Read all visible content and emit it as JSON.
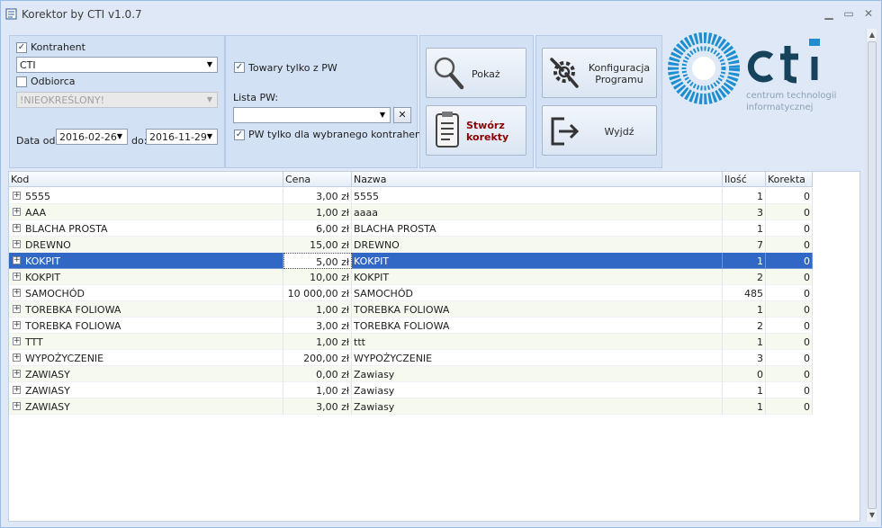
{
  "window": {
    "title": "Korektor by CTI v1.0.7"
  },
  "filters": {
    "kontrahent_label": "Kontrahent",
    "kontrahent_checked": true,
    "kontrahent_value": "CTI",
    "odbiorca_label": "Odbiorca",
    "odbiorca_checked": false,
    "odbiorca_value": "!NIEOKREŚLONY!",
    "date_from_label": "Data od:",
    "date_from": "2016-02-26",
    "date_to_label": "do:",
    "date_to": "2016-11-29"
  },
  "pw": {
    "towary_label": "Towary tylko z PW",
    "towary_checked": true,
    "lista_label": "Lista PW:",
    "lista_value": "",
    "clear_label": "✕",
    "tylko_label": "PW tylko dla wybranego kontrahenta",
    "tylko_checked": true
  },
  "buttons": {
    "pokaz": "Pokaż",
    "stworz_line1": "Stwórz",
    "stworz_line2": "korekty",
    "konfig_line1": "Konfiguracja",
    "konfig_line2": "Programu",
    "wyjdz": "Wyjdź"
  },
  "logo": {
    "brand": "cti",
    "tagline1": "centrum technologii",
    "tagline2": "informatycznej"
  },
  "grid": {
    "columns": [
      "Kod",
      "Cena",
      "Nazwa",
      "Ilość",
      "Korekta"
    ],
    "rows": [
      {
        "kod": "5555",
        "cena": "3,00 zł",
        "nazwa": "5555",
        "ilosc": "1",
        "korekta": "0"
      },
      {
        "kod": "AAA",
        "cena": "1,00 zł",
        "nazwa": "aaaa",
        "ilosc": "3",
        "korekta": "0"
      },
      {
        "kod": "BLACHA PROSTA",
        "cena": "6,00 zł",
        "nazwa": "BLACHA PROSTA",
        "ilosc": "1",
        "korekta": "0"
      },
      {
        "kod": "DREWNO",
        "cena": "15,00 zł",
        "nazwa": "DREWNO",
        "ilosc": "7",
        "korekta": "0"
      },
      {
        "kod": "KOKPIT",
        "cena": "5,00 zł",
        "nazwa": "KOKPIT",
        "ilosc": "1",
        "korekta": "0"
      },
      {
        "kod": "KOKPIT",
        "cena": "10,00 zł",
        "nazwa": "KOKPIT",
        "ilosc": "2",
        "korekta": "0"
      },
      {
        "kod": "SAMOCHÓD",
        "cena": "10 000,00 zł",
        "nazwa": "SAMOCHÓD",
        "ilosc": "485",
        "korekta": "0"
      },
      {
        "kod": "TOREBKA FOLIOWA",
        "cena": "1,00 zł",
        "nazwa": "TOREBKA FOLIOWA",
        "ilosc": "1",
        "korekta": "0"
      },
      {
        "kod": "TOREBKA FOLIOWA",
        "cena": "3,00 zł",
        "nazwa": "TOREBKA FOLIOWA",
        "ilosc": "2",
        "korekta": "0"
      },
      {
        "kod": "TTT",
        "cena": "1,00 zł",
        "nazwa": "ttt",
        "ilosc": "1",
        "korekta": "0"
      },
      {
        "kod": "WYPOŻYCZENIE",
        "cena": "200,00 zł",
        "nazwa": "WYPOŻYCZENIE",
        "ilosc": "3",
        "korekta": "0"
      },
      {
        "kod": "ZAWIASY",
        "cena": "0,00 zł",
        "nazwa": "Zawiasy",
        "ilosc": "0",
        "korekta": "0"
      },
      {
        "kod": "ZAWIASY",
        "cena": "1,00 zł",
        "nazwa": "Zawiasy",
        "ilosc": "1",
        "korekta": "0"
      },
      {
        "kod": "ZAWIASY",
        "cena": "3,00 zł",
        "nazwa": "Zawiasy",
        "ilosc": "1",
        "korekta": "0"
      }
    ],
    "selected_index": 4
  },
  "colors": {
    "selection": "#3168c6",
    "logo_blue": "#1d8fd1",
    "logo_dark": "#16425c",
    "stworz_text": "#8b0000"
  },
  "icons": {
    "app": "app-icon",
    "pokaz": "magnifier-icon",
    "stworz": "document-list-icon",
    "konfig": "wrench-gear-icon",
    "wyjdz": "exit-door-icon",
    "expand": "plus-box-icon"
  }
}
